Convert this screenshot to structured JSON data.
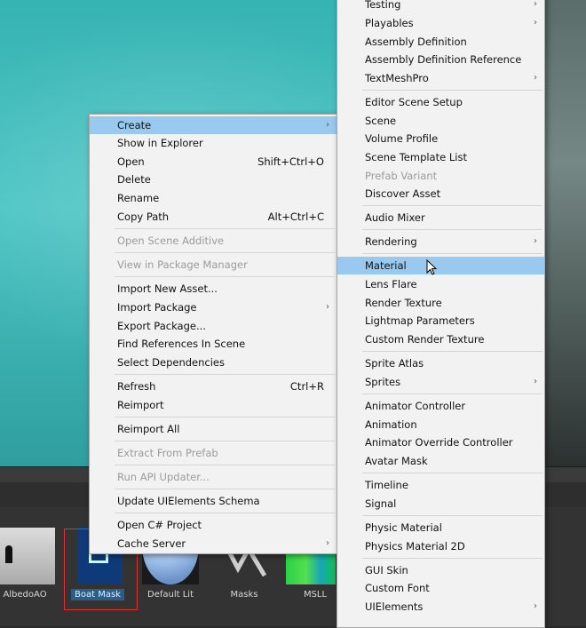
{
  "assets": {
    "items": [
      {
        "label": "AlbedoAO"
      },
      {
        "label": "Boat Mask"
      },
      {
        "label": "Default Lit"
      },
      {
        "label": "Masks"
      },
      {
        "label": "MSLL"
      }
    ]
  },
  "context_menu": {
    "items": [
      {
        "label": "Create",
        "submenu": true,
        "highlighted": true
      },
      {
        "label": "Show in Explorer"
      },
      {
        "label": "Open",
        "shortcut": "Shift+Ctrl+O"
      },
      {
        "label": "Delete"
      },
      {
        "label": "Rename"
      },
      {
        "label": "Copy Path",
        "shortcut": "Alt+Ctrl+C"
      },
      {
        "label": "Open Scene Additive",
        "disabled": true
      },
      {
        "label": "View in Package Manager",
        "disabled": true
      },
      {
        "label": "Import New Asset..."
      },
      {
        "label": "Import Package",
        "submenu": true
      },
      {
        "label": "Export Package..."
      },
      {
        "label": "Find References In Scene"
      },
      {
        "label": "Select Dependencies"
      },
      {
        "label": "Refresh",
        "shortcut": "Ctrl+R"
      },
      {
        "label": "Reimport"
      },
      {
        "label": "Reimport All"
      },
      {
        "label": "Extract From Prefab",
        "disabled": true
      },
      {
        "label": "Run API Updater...",
        "disabled": true
      },
      {
        "label": "Update UIElements Schema"
      },
      {
        "label": "Open C# Project"
      },
      {
        "label": "Cache Server",
        "submenu": true
      }
    ]
  },
  "create_submenu": {
    "items": [
      {
        "label": "Testing",
        "submenu": true
      },
      {
        "label": "Playables",
        "submenu": true
      },
      {
        "label": "Assembly Definition"
      },
      {
        "label": "Assembly Definition Reference"
      },
      {
        "label": "TextMeshPro",
        "submenu": true
      },
      {
        "label": "Editor Scene Setup"
      },
      {
        "label": "Scene"
      },
      {
        "label": "Volume Profile"
      },
      {
        "label": "Scene Template List"
      },
      {
        "label": "Prefab Variant",
        "disabled": true
      },
      {
        "label": "Discover Asset"
      },
      {
        "label": "Audio Mixer"
      },
      {
        "label": "Rendering",
        "submenu": true
      },
      {
        "label": "Material",
        "highlighted": true
      },
      {
        "label": "Lens Flare"
      },
      {
        "label": "Render Texture"
      },
      {
        "label": "Lightmap Parameters"
      },
      {
        "label": "Custom Render Texture"
      },
      {
        "label": "Sprite Atlas"
      },
      {
        "label": "Sprites",
        "submenu": true
      },
      {
        "label": "Animator Controller"
      },
      {
        "label": "Animation"
      },
      {
        "label": "Animator Override Controller"
      },
      {
        "label": "Avatar Mask"
      },
      {
        "label": "Timeline"
      },
      {
        "label": "Signal"
      },
      {
        "label": "Physic Material"
      },
      {
        "label": "Physics Material 2D"
      },
      {
        "label": "GUI Skin"
      },
      {
        "label": "Custom Font"
      },
      {
        "label": "UIElements",
        "submenu": true
      }
    ]
  },
  "colors": {
    "highlight": "#99c9ef",
    "selection_box": "#e0312c"
  }
}
